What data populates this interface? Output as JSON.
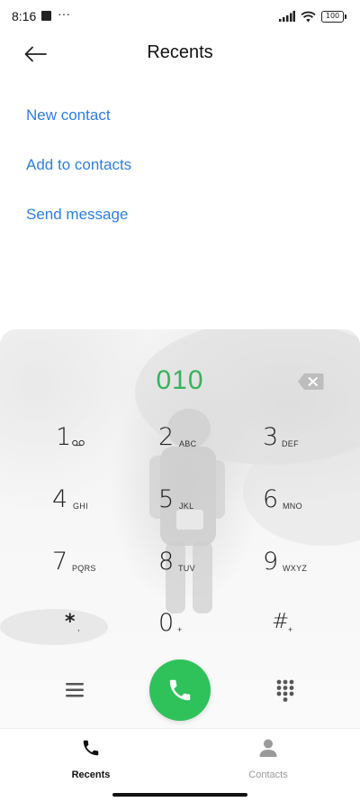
{
  "status_bar": {
    "time": "8:16",
    "dots": "···",
    "battery": "100"
  },
  "header": {
    "title": "Recents",
    "back_icon": "arrow-left-icon"
  },
  "actions": {
    "new_contact": "New contact",
    "add_to_contacts": "Add to contacts",
    "send_message": "Send message"
  },
  "dialer": {
    "number": "010",
    "number_color": "#36b35a",
    "keys": [
      {
        "digit": "1",
        "letters": "voicemail-icon"
      },
      {
        "digit": "2",
        "letters": "ABC"
      },
      {
        "digit": "3",
        "letters": "DEF"
      },
      {
        "digit": "4",
        "letters": "GHI"
      },
      {
        "digit": "5",
        "letters": "JKL"
      },
      {
        "digit": "6",
        "letters": "MNO"
      },
      {
        "digit": "7",
        "letters": "PQRS"
      },
      {
        "digit": "8",
        "letters": "TUV"
      },
      {
        "digit": "9",
        "letters": "WXYZ"
      },
      {
        "digit": "*",
        "letters": ","
      },
      {
        "digit": "0",
        "letters": "+"
      },
      {
        "digit": "#",
        "letters": "+"
      }
    ],
    "call_color": "#2fc25a"
  },
  "bottom_nav": {
    "recents": "Recents",
    "contacts": "Contacts"
  },
  "colors": {
    "link": "#2d7fe0",
    "accent_green": "#2fc25a"
  }
}
